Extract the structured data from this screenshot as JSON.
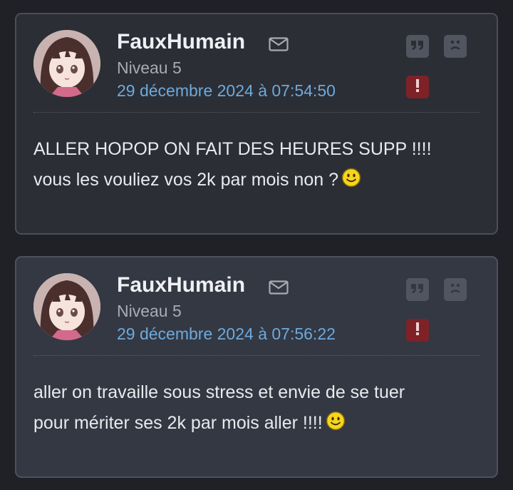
{
  "colors": {
    "page_bg": "#1f2126",
    "card_bg": "#2b2e35",
    "card_bg_alt": "#333843",
    "username": "#eef0f3",
    "level": "#a8abb2",
    "date_link": "#6eaadc",
    "report_red": "#7e2228",
    "button_gray": "#505560"
  },
  "posts": [
    {
      "username": "FauxHumain",
      "level": "Niveau 5",
      "date": "29 décembre 2024 à 07:54:50",
      "lines": [
        "ALLER HOPOP ON FAIT DES HEURES SUPP !!!!",
        "vous les vouliez vos 2k par mois non ?"
      ],
      "emoji": "smiley-emoji",
      "icons": [
        "mail-icon",
        "quote-icon",
        "sad-face-icon",
        "report-icon"
      ]
    },
    {
      "username": "FauxHumain",
      "level": "Niveau 5",
      "date": "29 décembre 2024 à 07:56:22",
      "lines": [
        "aller on travaille sous stress et envie de se tuer",
        "pour mériter ses 2k par mois aller !!!!"
      ],
      "emoji": "smiley-emoji",
      "icons": [
        "mail-icon",
        "quote-icon",
        "sad-face-icon",
        "report-icon"
      ]
    }
  ]
}
